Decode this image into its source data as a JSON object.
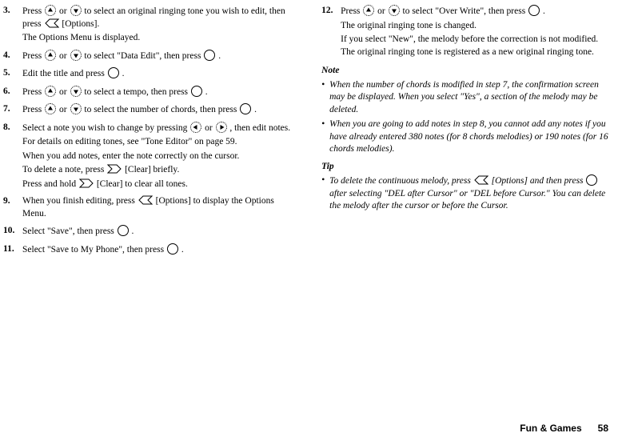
{
  "left": {
    "s3": {
      "num": "3.",
      "l1a": "Press ",
      "l1b": " or ",
      "l1c": " to select an original ringing tone you wish to edit, then press ",
      "l1d": " [Options].",
      "l2": "The Options Menu is displayed."
    },
    "s4": {
      "num": "4.",
      "l1a": "Press ",
      "l1b": " or ",
      "l1c": " to select \"Data Edit\", then press ",
      "l1d": "."
    },
    "s5": {
      "num": "5.",
      "l1a": "Edit the title and press ",
      "l1b": "."
    },
    "s6": {
      "num": "6.",
      "l1a": "Press ",
      "l1b": " or ",
      "l1c": " to select a tempo, then press ",
      "l1d": "."
    },
    "s7": {
      "num": "7.",
      "l1a": "Press ",
      "l1b": " or ",
      "l1c": " to select the number of chords, then press ",
      "l1d": "."
    },
    "s8": {
      "num": "8.",
      "l1a": "Select a note you wish to change by pressing ",
      "l1b": " or ",
      "l1c": ", then edit notes.",
      "l2": "For details on editing tones, see \"Tone Editor\" on page 59.",
      "l3": "When you add notes, enter the note correctly on the cursor.",
      "l4a": "To delete a note, press ",
      "l4b": " [Clear] briefly.",
      "l5a": "Press and hold ",
      "l5b": " [Clear] to clear all tones."
    },
    "s9": {
      "num": "9.",
      "l1a": "When you finish editing, press ",
      "l1b": " [Options] to display the Options Menu."
    },
    "s10": {
      "num": "10.",
      "l1a": "Select \"Save\", then press ",
      "l1b": "."
    },
    "s11": {
      "num": "11.",
      "l1a": "Select \"Save to My Phone\", then press ",
      "l1b": "."
    }
  },
  "right": {
    "s12": {
      "num": "12.",
      "l1a": "Press ",
      "l1b": " or ",
      "l1c": " to select \"Over Write\", then press ",
      "l1d": ".",
      "l2": "The original ringing tone is changed.",
      "l3": "If you select \"New\", the melody before the correction is not modified. The original ringing tone is registered as a new original ringing tone."
    },
    "noteHeading": "Note",
    "note1": "When the number of chords is modified in step 7, the confirmation screen may be displayed. When you select \"Yes\", a section of the melody may be deleted.",
    "note2": "When you are going to add notes in step 8, you cannot add any notes if you have already entered 380 notes (for 8 chords melodies) or 190 notes (for 16 chords melodies).",
    "tipHeading": "Tip",
    "tip1a": "To delete the continuous melody, press ",
    "tip1b": " [Options] and then press ",
    "tip1c": " after selecting \"DEL after Cursor\" or \"DEL before Cursor.\" You can delete the melody after the cursor or before the Cursor."
  },
  "footer": {
    "section": "Fun & Games",
    "page": "58"
  }
}
